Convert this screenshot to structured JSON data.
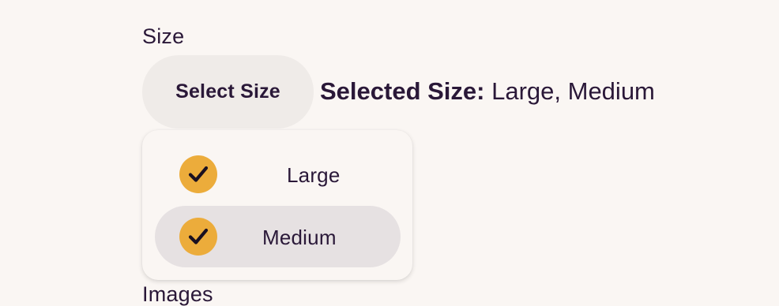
{
  "size_label": "Size",
  "select_button_label": "Select Size",
  "selected": {
    "prefix": "Selected Size:",
    "value": "Large, Medium"
  },
  "options": [
    {
      "label": "Large",
      "checked": true,
      "highlighted": false
    },
    {
      "label": "Medium",
      "checked": true,
      "highlighted": true
    }
  ],
  "images_label": "Images",
  "colors": {
    "background": "#faf6f3",
    "text": "#2a1838",
    "button_bg": "#efebe8",
    "highlight_bg": "#e6e1e2",
    "check_bg": "#ecac3b"
  },
  "icons": {
    "check": "checkmark-icon"
  }
}
